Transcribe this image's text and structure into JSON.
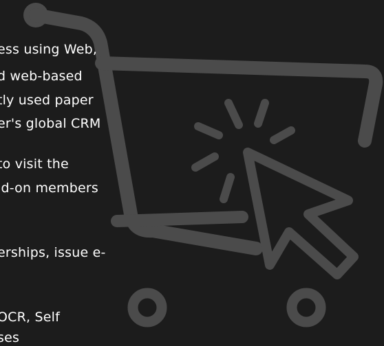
{
  "text_lines": [
    "ess using Web,",
    "d web-based",
    "tly used paper",
    "er's global CRM",
    "to visit the",
    "ld-on members",
    "erships, issue e-",
    "OCR, Self",
    "ses"
  ],
  "icon": "shopping-cart-cursor-click-icon",
  "colors": {
    "background": "#1c1c1c",
    "icon": "#4b4b4b",
    "text": "#ffffff"
  }
}
